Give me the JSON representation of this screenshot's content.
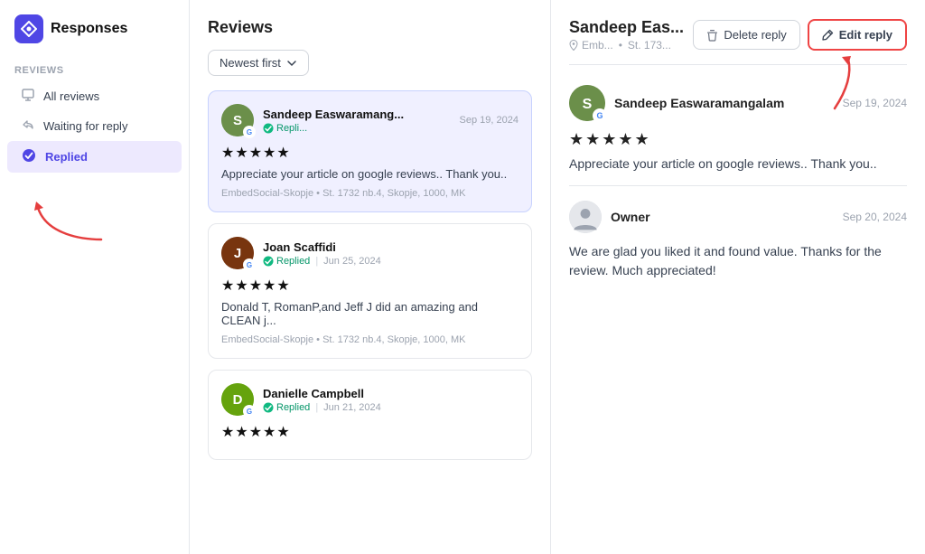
{
  "app": {
    "title": "Responses",
    "logo_symbol": "◈"
  },
  "sidebar": {
    "section_label": "Reviews",
    "items": [
      {
        "id": "all-reviews",
        "label": "All reviews",
        "icon": "🖥",
        "active": false
      },
      {
        "id": "waiting-reply",
        "label": "Waiting for reply",
        "icon": "↩",
        "active": false
      },
      {
        "id": "replied",
        "label": "Replied",
        "icon": "✓",
        "active": true
      }
    ]
  },
  "reviews_panel": {
    "title": "Reviews",
    "sort_label": "Newest first",
    "reviews": [
      {
        "id": "r1",
        "name": "Sandeep Easwaramang...",
        "avatar_letter": "S",
        "avatar_color": "#6b8f4a",
        "status": "Repli...",
        "date": "Sep 19, 2024",
        "stars": "★★★★★",
        "text": "Appreciate your article on google reviews.. Thank you..",
        "source": "EmbedSocial-Skopje  •  St. 1732 nb.4, Skopje, 1000, MK",
        "active": true
      },
      {
        "id": "r2",
        "name": "Joan Scaffidi",
        "avatar_letter": "J",
        "avatar_color": "#78350f",
        "status": "Replied",
        "date": "Jun 25, 2024",
        "stars": "★★★★★",
        "text": "Donald T, RomanP,and Jeff J did an amazing and CLEAN j...",
        "source": "EmbedSocial-Skopje  •  St. 1732 nb.4, Skopje, 1000, MK",
        "active": false
      },
      {
        "id": "r3",
        "name": "Danielle Campbell",
        "avatar_letter": "D",
        "avatar_color": "#65a30d",
        "status": "Replied",
        "date": "Jun 21, 2024",
        "stars": "★★★★★",
        "text": "",
        "source": "",
        "active": false
      }
    ]
  },
  "detail_panel": {
    "name": "Sandeep Eas...",
    "meta_location": "Emb...",
    "meta_source": "St. 173...",
    "delete_reply_label": "Delete reply",
    "edit_reply_label": "Edit reply",
    "review": {
      "reviewer_name": "Sandeep Easwaramangalam",
      "date": "Sep 19, 2024",
      "stars": "★★★★★",
      "text": "Appreciate your article on google reviews.. Thank you.."
    },
    "owner_reply": {
      "name": "Owner",
      "date": "Sep 20, 2024",
      "text": "We are glad you liked it and found value. Thanks for the review. Much appreciated!"
    }
  },
  "icons": {
    "logo": "◈",
    "monitor": "🖥",
    "reply_back": "↩",
    "check_circle": "✓",
    "location_pin": "📍",
    "trash": "🗑",
    "edit": "✏",
    "chevron_down": "▾",
    "google_g": "G"
  },
  "colors": {
    "accent": "#4f46e5",
    "active_bg": "#ede9fe",
    "active_border": "#c7d2fe",
    "review_active_bg": "#f0f0ff",
    "edit_btn_border": "#ef4444",
    "star_color": "#111111",
    "success_green": "#10b981"
  }
}
